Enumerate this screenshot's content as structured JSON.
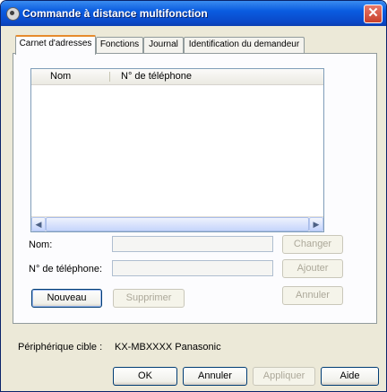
{
  "window": {
    "title": "Commande à distance multifonction",
    "close_glyph": "✕"
  },
  "tabs": [
    {
      "label": "Carnet d'adresses",
      "active": true
    },
    {
      "label": "Fonctions",
      "active": false
    },
    {
      "label": "Journal",
      "active": false
    },
    {
      "label": "Identification du demandeur",
      "active": false
    }
  ],
  "list": {
    "columns": [
      "Nom",
      "N° de téléphone"
    ],
    "rows": []
  },
  "form": {
    "name_label": "Nom:",
    "phone_label": "N° de téléphone:",
    "name_value": "",
    "phone_value": ""
  },
  "buttons": {
    "change": "Changer",
    "add": "Ajouter",
    "cancel_edit": "Annuler",
    "new": "Nouveau",
    "delete": "Supprimer"
  },
  "device": {
    "label": "Périphérique cible :",
    "value": "KX-MBXXXX Panasonic"
  },
  "footer": {
    "ok": "OK",
    "cancel": "Annuler",
    "apply": "Appliquer",
    "help": "Aide"
  },
  "scroll": {
    "left_arrow": "◀",
    "right_arrow": "▶"
  }
}
